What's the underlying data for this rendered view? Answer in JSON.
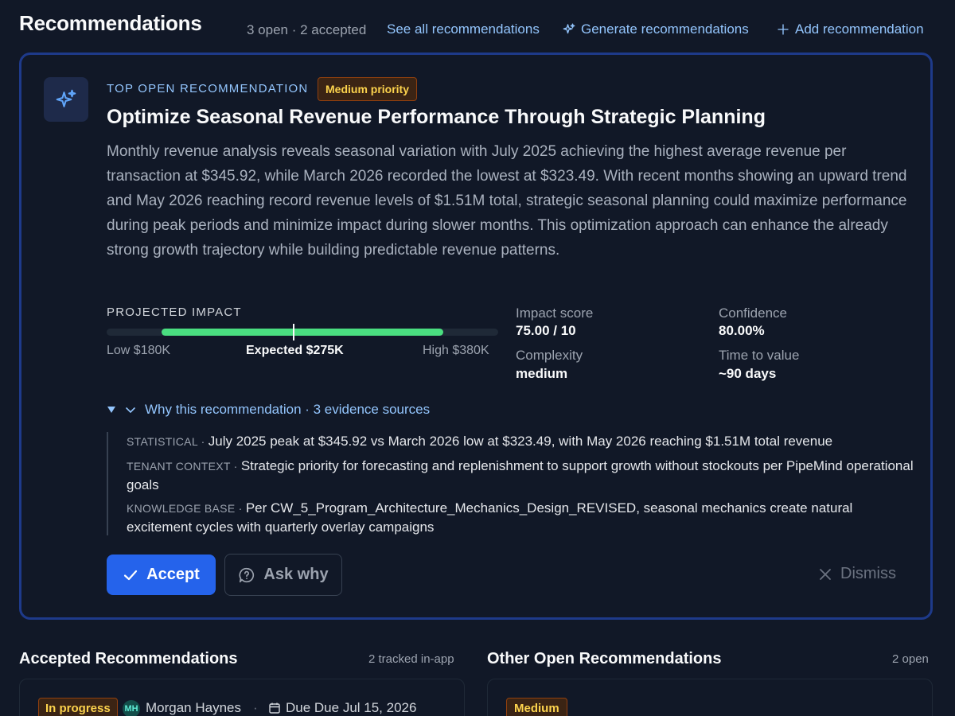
{
  "header": {
    "title": "Recommendations",
    "status": "3 open · 2 accepted",
    "see_all": "See all recommendations",
    "generate": "Generate recommendations",
    "add": "Add recommendation"
  },
  "top_card": {
    "eyebrow": "TOP OPEN RECOMMENDATION",
    "priority": "Medium priority",
    "title": "Optimize Seasonal Revenue Performance Through Strategic Planning",
    "body": "Monthly revenue analysis reveals seasonal variation with July 2025 achieving the highest average revenue per transaction at $345.92, while March 2026 recorded the lowest at $323.49. With recent months showing an upward trend and May 2026 reaching record revenue levels of $1.51M total, strategic seasonal planning could maximize performance during peak periods and minimize impact during slower months. This optimization approach can enhance the already strong growth trajectory while building predictable revenue patterns.",
    "impact": {
      "label": "PROJECTED IMPACT",
      "low": "Low $180K",
      "expected": "Expected $275K",
      "high": "High $380K",
      "low_value": 180,
      "expected_value": 275,
      "high_value": 380,
      "bar_color": "#4ade80"
    },
    "metrics": {
      "impact_score_label": "Impact score",
      "impact_score": "75.00 / 10",
      "confidence_label": "Confidence",
      "confidence": "80.00%",
      "complexity_label": "Complexity",
      "complexity": "medium",
      "time_label": "Time to value",
      "time": "~90 days"
    },
    "why": {
      "label": "Why this recommendation · 3 evidence sources",
      "evidence": [
        {
          "tag": "STATISTICAL",
          "text": "July 2025 peak at $345.92 vs March 2026 low at $323.49, with May 2026 reaching $1.51M total revenue"
        },
        {
          "tag": "TENANT CONTEXT",
          "text": "Strategic priority for forecasting and replenishment to support growth without stockouts per PipeMind operational goals"
        },
        {
          "tag": "KNOWLEDGE BASE",
          "text": "Per CW_5_Program_Architecture_Mechanics_Design_REVISED, seasonal mechanics create natural excitement cycles with quarterly overlay campaigns"
        }
      ]
    },
    "actions": {
      "accept": "Accept",
      "ask_why": "Ask why",
      "dismiss": "Dismiss"
    }
  },
  "accepted": {
    "title": "Accepted Recommendations",
    "meta": "2 tracked in-app",
    "first": {
      "status": "In progress",
      "initials": "MH",
      "owner": "Morgan Haynes",
      "separator": "·",
      "due": "Due Due Jul 15, 2026"
    }
  },
  "other_open": {
    "title": "Other Open Recommendations",
    "meta": "2 open",
    "first": {
      "priority": "Medium"
    }
  },
  "colors": {
    "background": "#111827",
    "accent": "#93c5fd",
    "primary_button": "#2563eb",
    "badge_text": "#fcd34d"
  }
}
